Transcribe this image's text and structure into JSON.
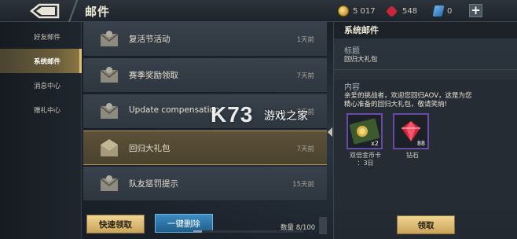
{
  "header": {
    "title": "邮件",
    "gold": "5 017",
    "gems": "548",
    "vouchers": "0",
    "plus_label": "+"
  },
  "sidebar": {
    "items": [
      {
        "label": "好友邮件"
      },
      {
        "label": "系统邮件"
      },
      {
        "label": "消息中心"
      },
      {
        "label": "赠礼中心"
      }
    ],
    "active_index": 1
  },
  "mail_list": [
    {
      "title": "复活节活动",
      "time": "1天前"
    },
    {
      "title": "赛季奖励领取",
      "time": "7天前"
    },
    {
      "title": "Update compensation",
      "time": "7天前"
    },
    {
      "title": "回归大礼包",
      "time": "7天前"
    },
    {
      "title": "队友惩罚提示",
      "time": "15天前"
    }
  ],
  "selected_index": 3,
  "bottom": {
    "quick_claim": "快速领取",
    "delete_all": "一键删除",
    "count_label": "数量 8/100",
    "progress": 0.08
  },
  "detail": {
    "header": "系统邮件",
    "title_label": "标题",
    "title_value": "回归大礼包",
    "content_label": "内容",
    "content_line1": "亲爱的挑战者，欢迎您回归AOV，这是为您",
    "content_line2": "精心准备的回归大礼包，敬请笑纳!",
    "rewards": [
      {
        "name_line1": "双倍金币卡",
        "name_line2": "：3日",
        "badge": "x2",
        "icon": "double-gold-card-icon"
      },
      {
        "name_line1": "钻石",
        "name_line2": "",
        "quantity": "88",
        "icon": "diamond-icon"
      }
    ],
    "claim_label": "领取"
  },
  "watermark": {
    "brand": "K73",
    "text": "游戏之家"
  },
  "colors": {
    "accent_gold": "#e3c278",
    "selected_row": "#5c5138",
    "blue_button": "#3f8cc0",
    "item_border": "#6a4aa8"
  }
}
